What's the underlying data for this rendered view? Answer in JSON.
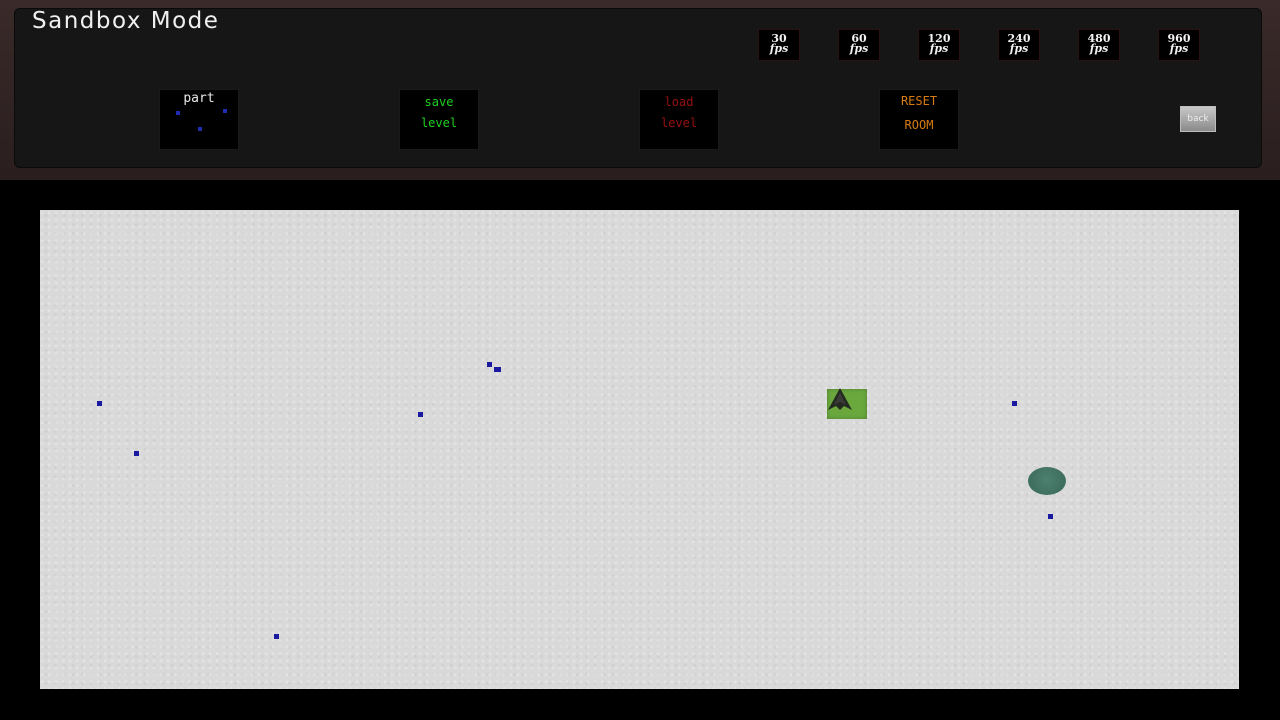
{
  "header": {
    "title": "Sandbox Mode"
  },
  "fps_options": [
    {
      "num": "30",
      "unit": "fps"
    },
    {
      "num": "60",
      "unit": "fps"
    },
    {
      "num": "120",
      "unit": "fps"
    },
    {
      "num": "240",
      "unit": "fps"
    },
    {
      "num": "480",
      "unit": "fps"
    },
    {
      "num": "960",
      "unit": "fps"
    }
  ],
  "tools": {
    "part": {
      "label": "part",
      "color": "#e8e8e8"
    },
    "save": {
      "line1": "save",
      "line2": "level",
      "color": "#1fd11f"
    },
    "load": {
      "line1": "load",
      "line2": "level",
      "color": "#9a1010"
    },
    "reset": {
      "line1": "RESET",
      "line2": "ROOM",
      "color": "#d77b12"
    },
    "back": {
      "label": "back"
    }
  },
  "arena": {
    "background": "#d9d9d9",
    "particle_color": "#1a1aa0",
    "player_color": "#6aa83e",
    "player_icon": "ship-icon",
    "orb_color": "#3e6e5e"
  }
}
